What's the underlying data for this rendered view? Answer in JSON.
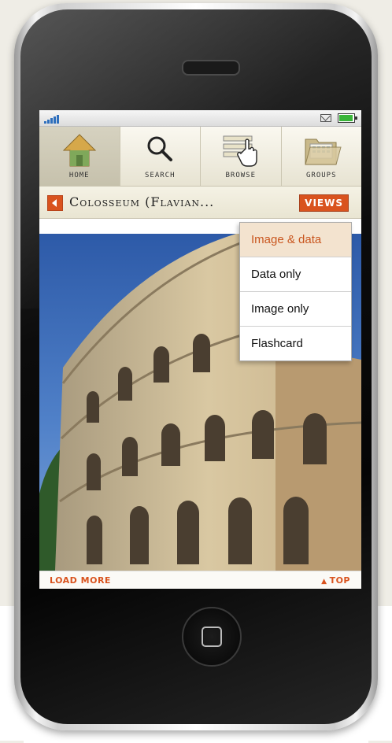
{
  "nav": {
    "items": [
      {
        "label": "HOME",
        "icon": "home-icon",
        "active": true
      },
      {
        "label": "SEARCH",
        "icon": "search-icon"
      },
      {
        "label": "BROWSE",
        "icon": "browse-icon"
      },
      {
        "label": "GROUPS",
        "icon": "groups-icon"
      }
    ]
  },
  "title": "Colosseum (Flavian...",
  "views_label": "VIEWS",
  "dropdown": {
    "items": [
      "Image & data",
      "Data only",
      "Image only",
      "Flashcard"
    ],
    "selected": "Image & data"
  },
  "footer": {
    "load_more": "LOAD MORE",
    "top": "TOP",
    "top_arrow": "▲"
  },
  "colors": {
    "accent": "#d9531e",
    "selected_bg": "#f3e3cf",
    "sky": "#3a6bb8"
  }
}
